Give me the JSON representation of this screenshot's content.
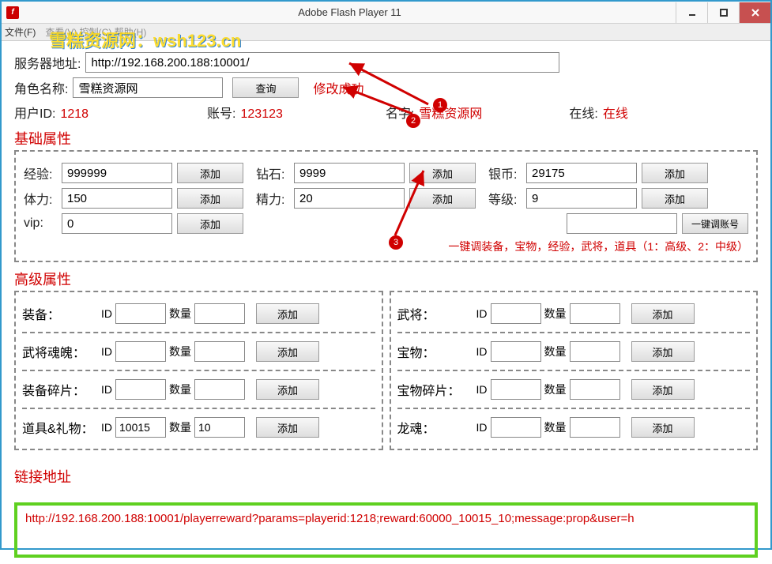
{
  "window": {
    "title": "Adobe Flash Player 11"
  },
  "menu": {
    "file": "文件(F)",
    "rest": "查看(V)  控制(C)  帮助(H)"
  },
  "watermark": "雪糕资源网：wsh123.cn",
  "server": {
    "label": "服务器地址:",
    "value": "http://192.168.200.188:10001/"
  },
  "role": {
    "label": "角色名称:",
    "value": "雪糕资源网",
    "queryBtn": "查询",
    "status": "修改成功"
  },
  "user": {
    "idLabel": "用户ID:",
    "idValue": "1218",
    "acctLabel": "账号:",
    "acctValue": "123123",
    "nameLabel": "名字:",
    "nameValue": "雪糕资源网",
    "onlineLabel": "在线:",
    "onlineValue": "在线"
  },
  "basicTitle": "基础属性",
  "basic": {
    "exp": {
      "label": "经验:",
      "value": "999999",
      "btn": "添加"
    },
    "diamond": {
      "label": "钻石:",
      "value": "9999",
      "btn": "添加"
    },
    "silver": {
      "label": "银币:",
      "value": "29175",
      "btn": "添加"
    },
    "stamina": {
      "label": "体力:",
      "value": "150",
      "btn": "添加"
    },
    "energy": {
      "label": "精力:",
      "value": "20",
      "btn": "添加"
    },
    "level": {
      "label": "等级:",
      "value": "9",
      "btn": "添加"
    },
    "vip": {
      "label": "vip:",
      "value": "0",
      "btn": "添加"
    },
    "oneKeyBtn": "一键调账号",
    "oneKeyNote": "一键调装备，宝物，经验，武将，道具（1：高级、2：中级）"
  },
  "advTitle": "高级属性",
  "adv": {
    "idLabel": "ID",
    "qtyLabel": "数量",
    "addBtn": "添加",
    "left": [
      {
        "label": "装备：",
        "id": "",
        "qty": ""
      },
      {
        "label": "武将魂魄：",
        "id": "",
        "qty": ""
      },
      {
        "label": "装备碎片：",
        "id": "",
        "qty": ""
      },
      {
        "label": "道具&礼物：",
        "id": "10015",
        "qty": "10"
      }
    ],
    "right": [
      {
        "label": "武将：",
        "id": "",
        "qty": ""
      },
      {
        "label": "宝物：",
        "id": "",
        "qty": ""
      },
      {
        "label": "宝物碎片：",
        "id": "",
        "qty": ""
      },
      {
        "label": "龙魂：",
        "id": "",
        "qty": ""
      }
    ]
  },
  "urlTitle": "链接地址",
  "url": "http://192.168.200.188:10001/playerreward?params=playerid:1218;reward:60000_10015_10;message:prop&user=h",
  "badges": {
    "b1": "1",
    "b2": "2",
    "b3": "3"
  }
}
